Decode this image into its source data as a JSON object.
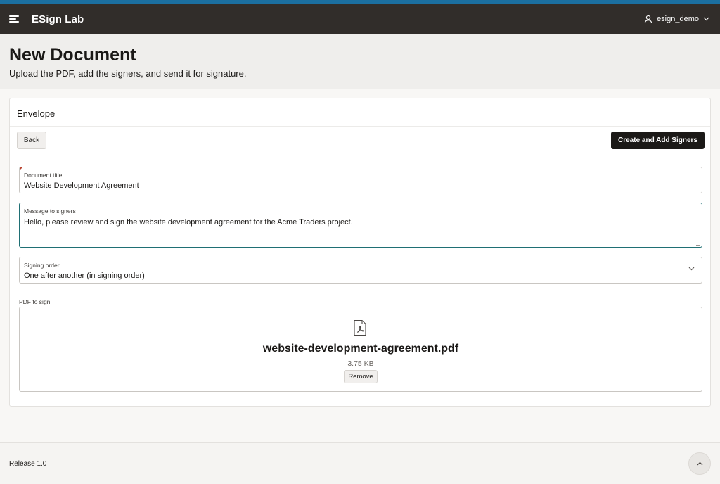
{
  "header": {
    "app_title": "ESign Lab",
    "username": "esign_demo",
    "icons": {
      "menu": "hamburger-menu-icon",
      "user": "user-icon",
      "dropdown": "chevron-down-icon"
    },
    "colors": {
      "top_accent": "#1b6fa0",
      "bar": "#312d2a"
    }
  },
  "page": {
    "title": "New Document",
    "subtitle": "Upload the PDF, add the signers, and send it for signature."
  },
  "envelope": {
    "title": "Envelope",
    "back_label": "Back",
    "primary_label": "Create and Add Signers",
    "fields": {
      "document_title": {
        "label": "Document title",
        "value": "Website Development Agreement",
        "required": true
      },
      "message": {
        "label": "Message to signers",
        "value": "Hello, please review and sign the website development agreement for the Acme Traders project."
      },
      "signing_order": {
        "label": "Signing order",
        "value": "One after another (in signing order)"
      }
    },
    "pdf": {
      "label": "PDF to sign",
      "icon": "pdf-file-icon",
      "file_name": "website-development-agreement.pdf",
      "file_size": "3.75 KB",
      "remove_label": "Remove"
    }
  },
  "footer": {
    "release": "Release 1.0",
    "scroll_top_icon": "chevron-up-icon"
  }
}
